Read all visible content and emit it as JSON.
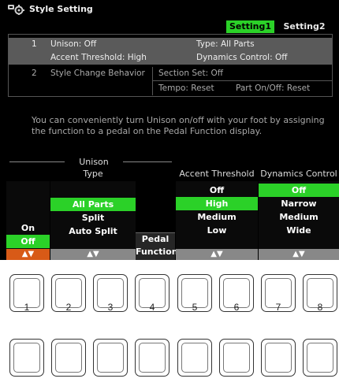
{
  "header": {
    "title": "Style Setting",
    "tabs": [
      {
        "label": "Setting1",
        "selected": true
      },
      {
        "label": "Setting2",
        "selected": false
      }
    ]
  },
  "summary": {
    "item1": {
      "number": "1",
      "unison": "Unison: Off",
      "type": "Type: All Parts",
      "accent": "Accent Threshold: High",
      "dynamics": "Dynamics Control: Off"
    },
    "item2": {
      "number": "2",
      "label": "Style Change Behavior",
      "section_set": "Section Set: Off",
      "tempo": "Tempo: Reset",
      "part_on_off": "Part On/Off: Reset"
    }
  },
  "info_text": "You can conveniently turn Unison on/off with your foot by assigning the function to a pedal on the Pedal Function display.",
  "controls": {
    "unison_label": "Unison",
    "type_label": "Type",
    "onoff": {
      "options": [
        "On",
        "Off"
      ],
      "selected": "Off",
      "arrows": "▲▼"
    },
    "type": {
      "options": [
        "All Parts",
        "Split",
        "Auto Split"
      ],
      "selected": "All Parts",
      "arrows": "▲▼"
    },
    "pedal_function": "Pedal Function",
    "pedal_line1": "Pedal",
    "pedal_line2": "Function",
    "accent_threshold": {
      "label": "Accent Threshold",
      "options": [
        "Off",
        "High",
        "Medium",
        "Low"
      ],
      "selected": "High",
      "arrows": "▲▼"
    },
    "dynamics_control": {
      "label": "Dynamics Control",
      "options": [
        "Off",
        "Narrow",
        "Medium",
        "Wide"
      ],
      "selected": "Off",
      "arrows": "▲▼"
    }
  },
  "buttons": {
    "numbers": [
      "1",
      "2",
      "3",
      "4",
      "5",
      "6",
      "7",
      "8"
    ]
  },
  "colors": {
    "selected": "#2bd128",
    "arrows_active": "#d85a17",
    "arrows_inactive": "#888888"
  },
  "icons": {
    "header": "style-setting-icon"
  }
}
